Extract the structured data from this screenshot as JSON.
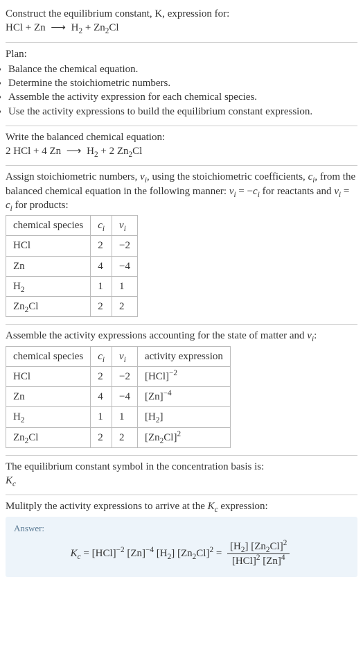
{
  "intro": {
    "line1": "Construct the equilibrium constant, K, expression for:",
    "reaction_lhs": "HCl + Zn",
    "reaction_rhs_h2": "H",
    "reaction_rhs_h2_sub": "2",
    "reaction_rhs_plus": " + Zn",
    "reaction_rhs_zn2cl_sub": "2",
    "reaction_rhs_end": "Cl"
  },
  "plan": {
    "heading": "Plan:",
    "items": [
      "Balance the chemical equation.",
      "Determine the stoichiometric numbers.",
      "Assemble the activity expression for each chemical species.",
      "Use the activity expressions to build the equilibrium constant expression."
    ]
  },
  "balanced": {
    "heading": "Write the balanced chemical equation:",
    "lhs": "2 HCl + 4 Zn",
    "rhs_h2": "H",
    "rhs_h2_sub": "2",
    "rhs_mid": " + 2 Zn",
    "rhs_zn2_sub": "2",
    "rhs_end": "Cl"
  },
  "assign": {
    "text_a": "Assign stoichiometric numbers, ",
    "nu_i": "ν",
    "nu_i_sub": "i",
    "text_b": ", using the stoichiometric coefficients, ",
    "c_i": "c",
    "c_i_sub": "i",
    "text_c": ", from the balanced chemical equation in the following manner: ",
    "rel1_lhs": "ν",
    "rel1_lhs_sub": "i",
    "rel1_eq": " = −",
    "rel1_rhs": "c",
    "rel1_rhs_sub": "i",
    "text_d": " for reactants and ",
    "rel2_lhs": "ν",
    "rel2_lhs_sub": "i",
    "rel2_eq": " = ",
    "rel2_rhs": "c",
    "rel2_rhs_sub": "i",
    "text_e": " for products:"
  },
  "table1": {
    "h1": "chemical species",
    "h2_base": "c",
    "h2_sub": "i",
    "h3_base": "ν",
    "h3_sub": "i",
    "rows": [
      {
        "sp": "HCl",
        "c": "2",
        "v": "−2"
      },
      {
        "sp": "Zn",
        "c": "4",
        "v": "−4"
      }
    ],
    "row_h2_pre": "H",
    "row_h2_sub": "2",
    "row_h2_c": "1",
    "row_h2_v": "1",
    "row_zn2cl_pre": "Zn",
    "row_zn2cl_sub": "2",
    "row_zn2cl_post": "Cl",
    "row_zn2cl_c": "2",
    "row_zn2cl_v": "2"
  },
  "activity": {
    "text_a": "Assemble the activity expressions accounting for the state of matter and ",
    "nu": "ν",
    "nu_sub": "i",
    "text_b": ":"
  },
  "table2": {
    "h1": "chemical species",
    "h2_base": "c",
    "h2_sub": "i",
    "h3_base": "ν",
    "h3_sub": "i",
    "h4": "activity expression",
    "r1_sp": "HCl",
    "r1_c": "2",
    "r1_v": "−2",
    "r1_ax_base": "[HCl]",
    "r1_ax_sup": "−2",
    "r2_sp": "Zn",
    "r2_c": "4",
    "r2_v": "−4",
    "r2_ax_base": "[Zn]",
    "r2_ax_sup": "−4",
    "r3_sp_pre": "H",
    "r3_sp_sub": "2",
    "r3_c": "1",
    "r3_v": "1",
    "r3_ax_pre": "[H",
    "r3_ax_sub": "2",
    "r3_ax_post": "]",
    "r4_sp_pre": "Zn",
    "r4_sp_sub": "2",
    "r4_sp_post": "Cl",
    "r4_c": "2",
    "r4_v": "2",
    "r4_ax_pre": "[Zn",
    "r4_ax_sub": "2",
    "r4_ax_post": "Cl]",
    "r4_ax_sup": "2"
  },
  "kconc": {
    "text": "The equilibrium constant symbol in the concentration basis is:",
    "sym": "K",
    "sym_sub": "c"
  },
  "mult": {
    "text_a": "Mulitply the activity expressions to arrive at the ",
    "k": "K",
    "k_sub": "c",
    "text_b": " expression:"
  },
  "answer": {
    "label": "Answer:",
    "kc": "K",
    "kc_sub": "c",
    "eq": " = ",
    "t1": "[HCl]",
    "t1_sup": "−2",
    "sp1": " ",
    "t2": "[Zn]",
    "t2_sup": "−4",
    "sp2": " ",
    "t3_pre": "[H",
    "t3_sub": "2",
    "t3_post": "]",
    "sp3": " ",
    "t4_pre": "[Zn",
    "t4_sub": "2",
    "t4_post": "Cl]",
    "t4_sup": "2",
    "eq2": " = ",
    "num_a_pre": "[H",
    "num_a_sub": "2",
    "num_a_post": "]",
    "num_sp": " ",
    "num_b_pre": "[Zn",
    "num_b_sub": "2",
    "num_b_post": "Cl]",
    "num_b_sup": "2",
    "den_a": "[HCl]",
    "den_a_sup": "2",
    "den_sp": " ",
    "den_b": "[Zn]",
    "den_b_sup": "4"
  }
}
